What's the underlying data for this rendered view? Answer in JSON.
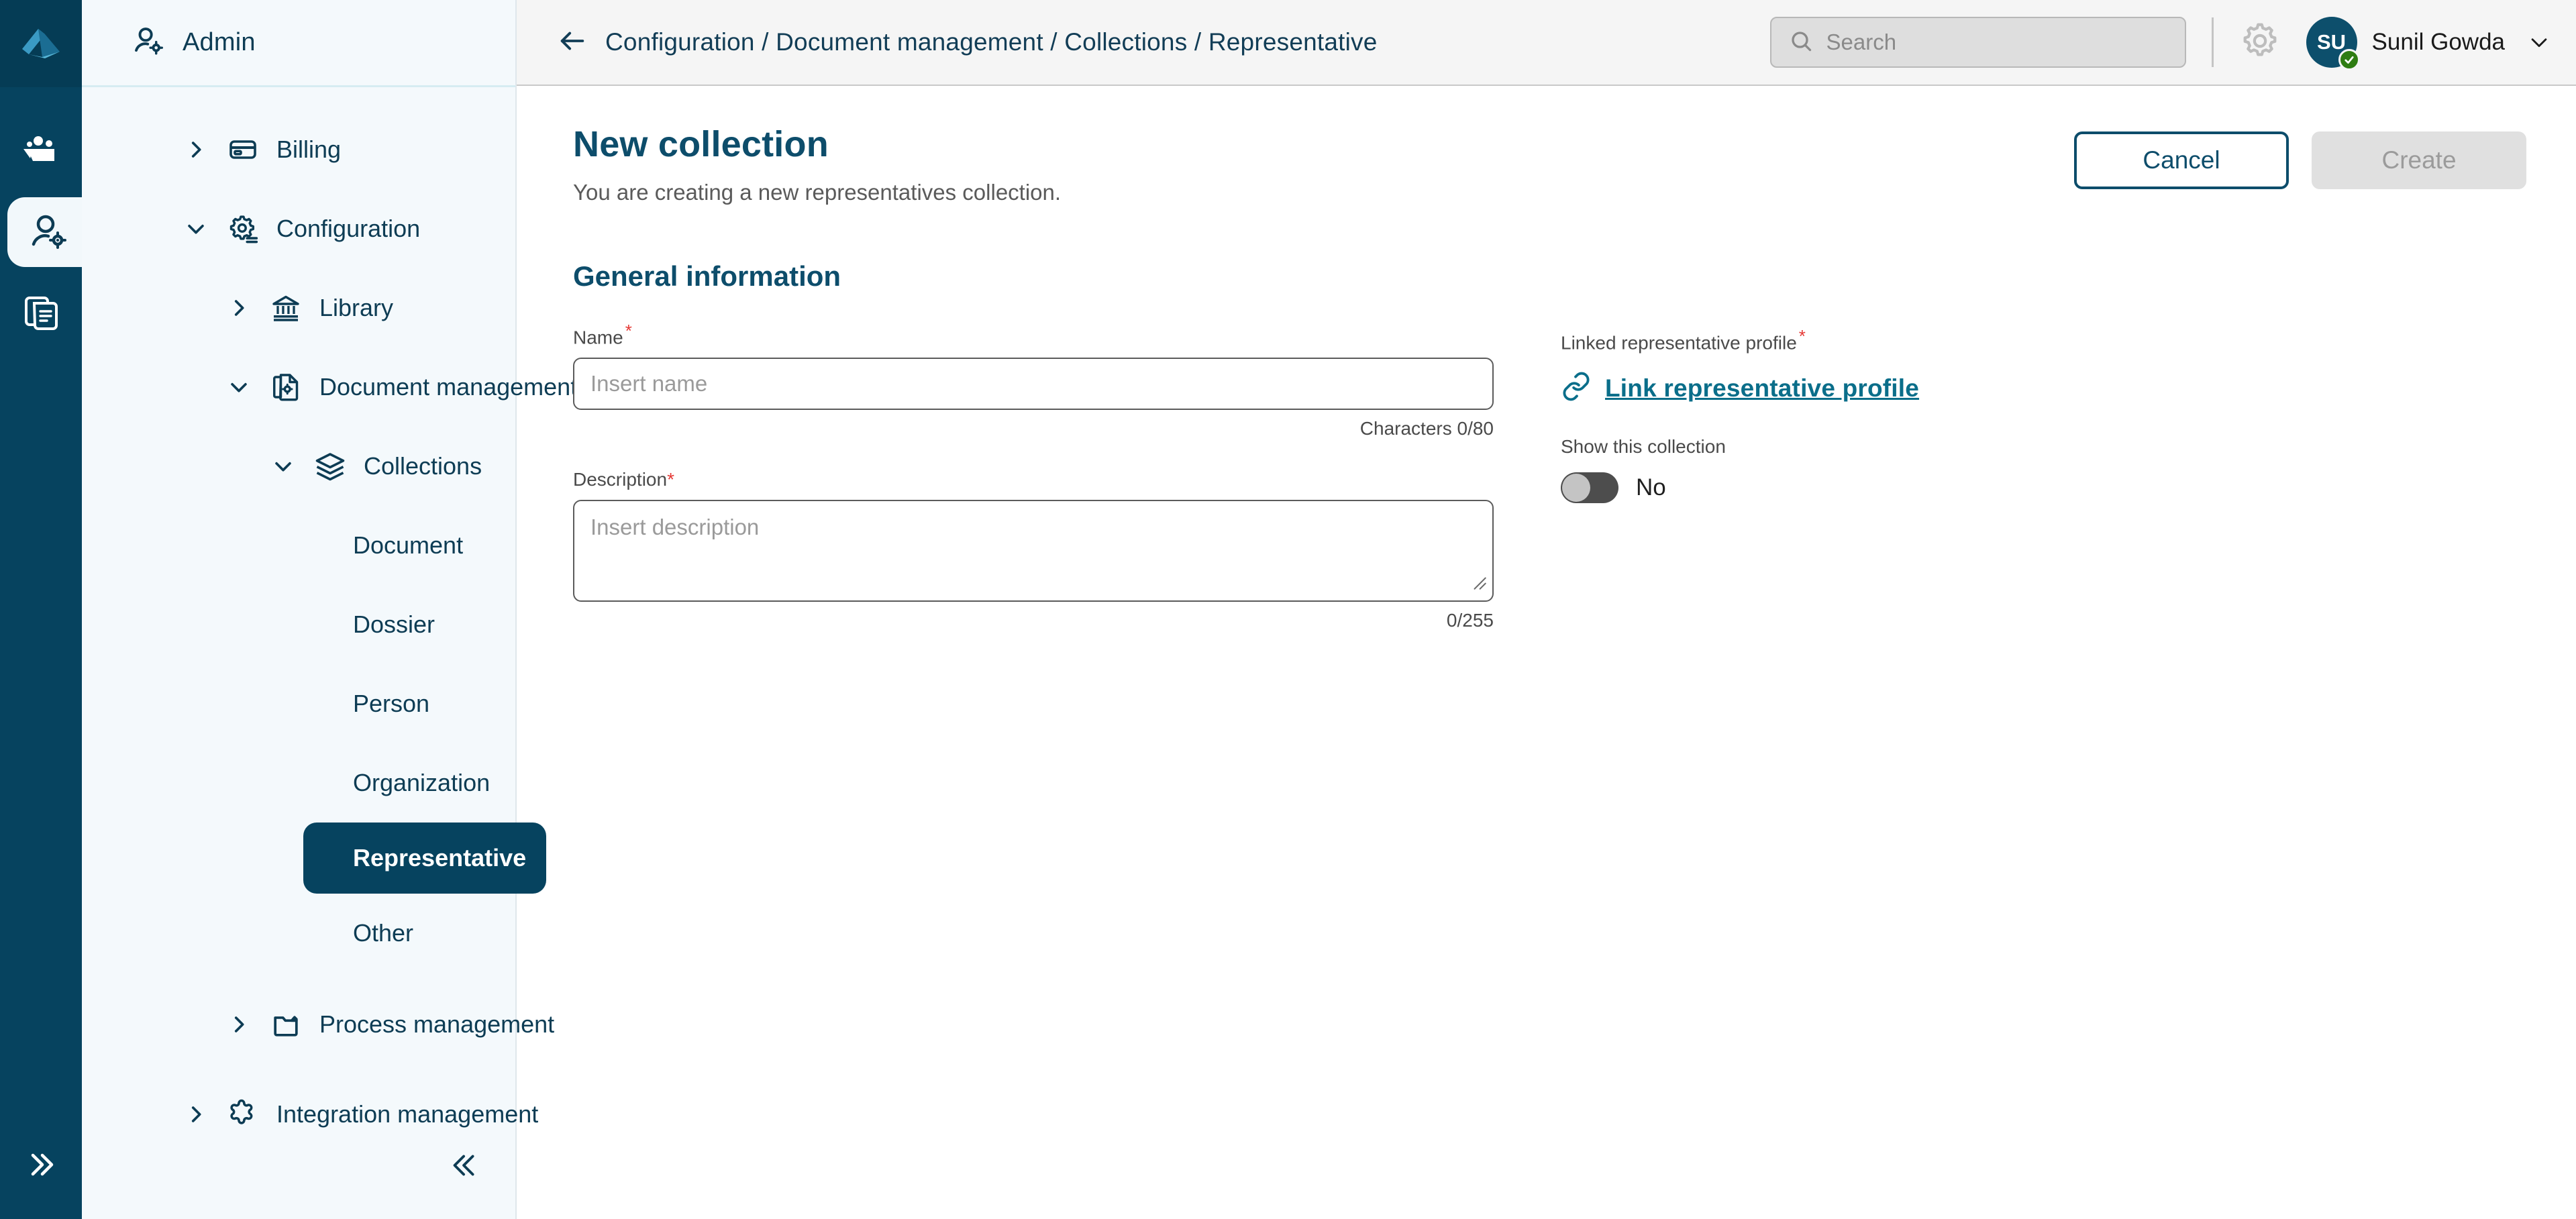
{
  "rail": {
    "logo_icon": "app-logo-icon",
    "items": [
      {
        "icon": "team-folder-icon",
        "name": "rail-item-teams",
        "active": false
      },
      {
        "icon": "admin-user-gear-icon",
        "name": "rail-item-admin",
        "active": true
      },
      {
        "icon": "documents-icon",
        "name": "rail-item-documents",
        "active": false
      }
    ],
    "expand_icon": "chevrons-right-icon"
  },
  "sidebar": {
    "header": {
      "icon": "admin-user-gear-icon",
      "title": "Admin"
    },
    "collapse_icon": "chevrons-left-icon",
    "nodes": [
      {
        "label": "Billing",
        "icon": "credit-card-icon",
        "chevron": "chevron-right",
        "level": 1,
        "name": "sidebar-item-billing"
      },
      {
        "label": "Configuration",
        "icon": "settings-gear-list-icon",
        "chevron": "chevron-down",
        "level": 1,
        "name": "sidebar-item-configuration"
      },
      {
        "label": "Library",
        "icon": "bank-icon",
        "chevron": "chevron-right",
        "level": 2,
        "name": "sidebar-item-library"
      },
      {
        "label": "Document management",
        "icon": "document-gear-icon",
        "chevron": "chevron-down",
        "level": 2,
        "name": "sidebar-item-document-management"
      },
      {
        "label": "Collections",
        "icon": "layers-icon",
        "chevron": "chevron-down",
        "level": 3,
        "name": "sidebar-item-collections"
      }
    ],
    "leaves": [
      {
        "label": "Document",
        "active": false,
        "name": "sidebar-item-document"
      },
      {
        "label": "Dossier",
        "active": false,
        "name": "sidebar-item-dossier"
      },
      {
        "label": "Person",
        "active": false,
        "name": "sidebar-item-person"
      },
      {
        "label": "Organization",
        "active": false,
        "name": "sidebar-item-organization"
      },
      {
        "label": "Representative",
        "active": true,
        "name": "sidebar-item-representative"
      },
      {
        "label": "Other",
        "active": false,
        "name": "sidebar-item-other"
      }
    ],
    "tail_nodes": [
      {
        "label": "Process management",
        "icon": "folder-icon",
        "chevron": "chevron-right",
        "level": 2,
        "name": "sidebar-item-process-management"
      },
      {
        "label": "Integration management",
        "icon": "puzzle-icon",
        "chevron": "chevron-right",
        "level": 1,
        "name": "sidebar-item-integration-management"
      }
    ]
  },
  "topbar": {
    "back_icon": "arrow-left-icon",
    "breadcrumb": "Configuration / Document management / Collections / Representative",
    "search": {
      "placeholder": "Search",
      "value": "",
      "icon": "search-icon"
    },
    "gear_icon": "gear-icon",
    "user": {
      "initials": "SU",
      "name": "Sunil Gowda",
      "status": "online",
      "caret_icon": "chevron-down-icon"
    }
  },
  "page": {
    "title": "New collection",
    "subtitle": "You are creating a new representatives collection.",
    "cancel_label": "Cancel",
    "create_label": "Create",
    "section_title": "General information",
    "name_field": {
      "label": "Name",
      "required": true,
      "placeholder": "Insert name",
      "value": "",
      "counter": "Characters 0/80"
    },
    "description_field": {
      "label": "Description",
      "required": true,
      "placeholder": "Insert description",
      "value": "",
      "counter": "0/255"
    },
    "linked_profile": {
      "label": "Linked representative profile",
      "required": true,
      "link_label": "Link representative profile",
      "link_icon": "link-icon"
    },
    "show_collection": {
      "label": "Show this collection",
      "value": "No",
      "on": false
    }
  },
  "colors": {
    "brand_navy": "#06435f",
    "sidebar_bg": "#f4f9fc",
    "accent_link": "#0a6e8a",
    "required_red": "#e53935",
    "status_green": "#2e7d12"
  }
}
